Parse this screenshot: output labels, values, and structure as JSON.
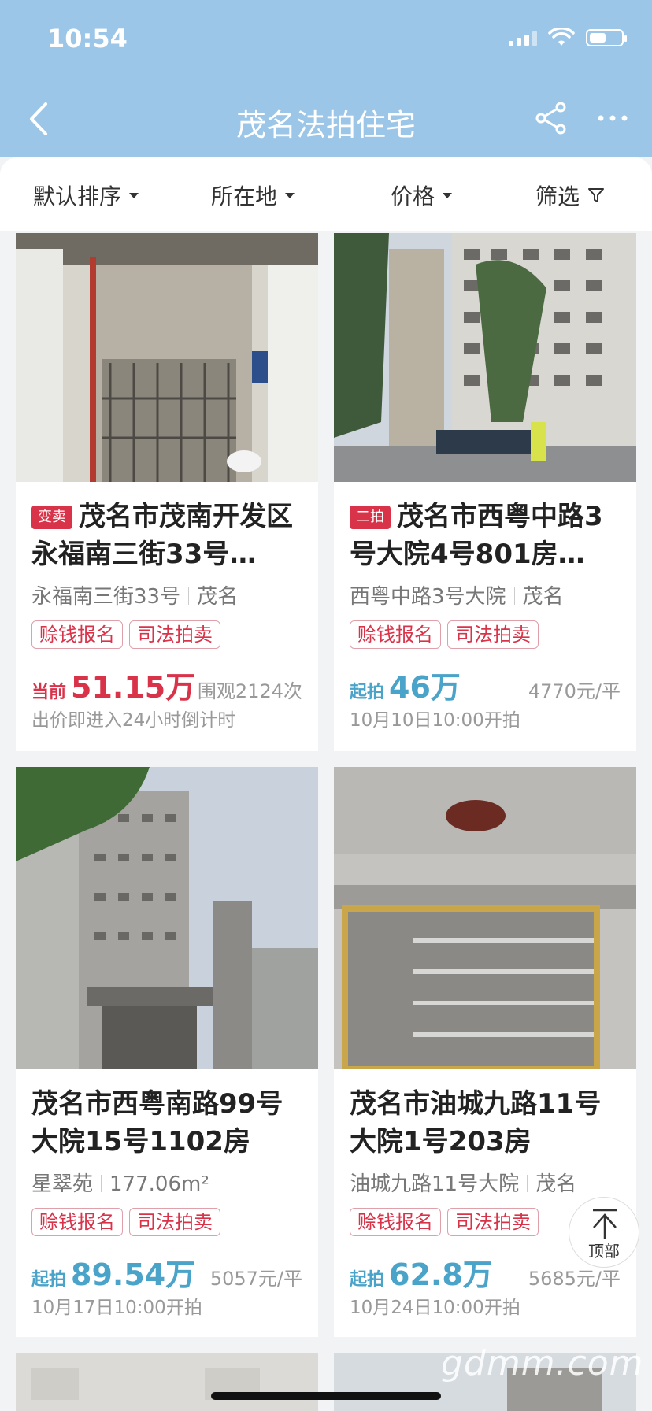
{
  "status": {
    "time": "10:54"
  },
  "nav": {
    "title": "茂名法拍住宅"
  },
  "filters": [
    {
      "label": "默认排序"
    },
    {
      "label": "所在地"
    },
    {
      "label": "价格"
    },
    {
      "label": "筛选"
    }
  ],
  "listings": [
    {
      "badge": "变卖",
      "title": "茂名市茂南开发区永福南三街33号…",
      "address": "永福南三街33号",
      "city": "茂名",
      "tags": [
        "赊钱报名",
        "司法拍卖"
      ],
      "price_label": "当前",
      "price": "51.15万",
      "right_info": "围观2124次",
      "footnote": "出价即进入24小时倒计时",
      "price_color": "#d9334a"
    },
    {
      "badge": "二拍",
      "title": "茂名市西粤中路3号大院4号801房…",
      "address": "西粤中路3号大院",
      "city": "茂名",
      "tags": [
        "赊钱报名",
        "司法拍卖"
      ],
      "price_label": "起拍",
      "price": "46万",
      "right_info": "4770元/平",
      "footnote": "10月10日10:00开拍",
      "price_color": "#4aa3c9"
    },
    {
      "badge": "",
      "title": "茂名市西粤南路99号大院15号1102房",
      "address": "星翠苑",
      "city": "177.06m²",
      "tags": [
        "赊钱报名",
        "司法拍卖"
      ],
      "price_label": "起拍",
      "price": "89.54万",
      "right_info": "5057元/平",
      "footnote": "10月17日10:00开拍",
      "price_color": "#4aa3c9"
    },
    {
      "badge": "",
      "title": "茂名市油城九路11号大院1号203房",
      "address": "油城九路11号大院",
      "city": "茂名",
      "tags": [
        "赊钱报名",
        "司法拍卖"
      ],
      "price_label": "起拍",
      "price": "62.8万",
      "right_info": "5685元/平",
      "footnote": "10月24日10:00开拍",
      "price_color": "#4aa3c9"
    }
  ],
  "top_button": {
    "label": "顶部"
  },
  "watermark": "gdmm.com",
  "colors": {
    "header": "#9cc6e7",
    "accent_red": "#d9334a",
    "accent_blue": "#4aa3c9"
  }
}
